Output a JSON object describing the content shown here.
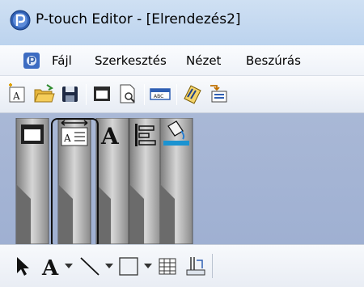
{
  "window": {
    "title": "P-touch Editor - [Elrendezés2]",
    "title_icon": "ptouch-editor-app-icon"
  },
  "menu": {
    "doc_icon": "document-icon",
    "items": [
      {
        "label": "Fájl"
      },
      {
        "label": "Szerkesztés"
      },
      {
        "label": "Nézet"
      },
      {
        "label": "Beszúrás"
      }
    ]
  },
  "toolbar": {
    "icons": [
      "new-layout-icon",
      "open-folder-icon",
      "save-icon",
      "print-icon",
      "print-preview-icon",
      "label-format-icon",
      "database-icon",
      "transfer-icon"
    ]
  },
  "palettes": {
    "strips": [
      {
        "icon": "window-icon"
      },
      {
        "icon": "layout-width-icon",
        "highlighted": true
      },
      {
        "icon": "text-format-icon"
      },
      {
        "icon": "align-icon"
      },
      {
        "icon": "fill-color-icon"
      }
    ]
  },
  "bottom_tools": {
    "icons": [
      "select-arrow-icon",
      "text-tool-icon",
      "line-tool-icon",
      "rectangle-tool-icon",
      "table-tool-icon",
      "barcode-tool-icon"
    ]
  },
  "colors": {
    "title_bg": "#c5daf1",
    "workspace_bg": "#a4b4d4",
    "strip_light": "#d4d4d4",
    "strip_dark": "#7a7a7a",
    "accent_blue": "#1a4fa0"
  }
}
